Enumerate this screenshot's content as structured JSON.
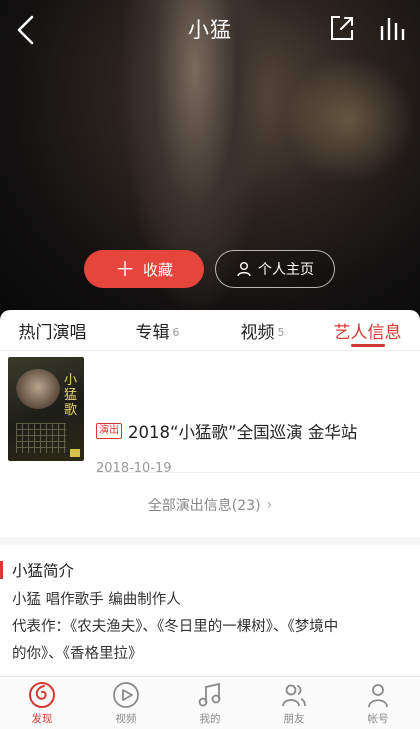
{
  "header": {
    "title": "小猛",
    "back_icon": "chevron-left-icon",
    "share_icon": "share-icon",
    "playing_icon": "now-playing-icon"
  },
  "actions": {
    "collect_label": "收藏",
    "homepage_label": "个人主页"
  },
  "tabs": [
    {
      "label": "热门演唱",
      "count": ""
    },
    {
      "label": "专辑",
      "count": "6"
    },
    {
      "label": "视频",
      "count": "5"
    },
    {
      "label": "艺人信息",
      "count": ""
    }
  ],
  "show": {
    "badge": "演出",
    "title": "2018“小猛歌”全国巡演 金华站",
    "date": "2018-10-19",
    "poster_text": "小猛歌"
  },
  "all_shows_label": "全部演出信息(23)",
  "intro": {
    "heading": "小猛简介",
    "line1": "小猛 唱作歌手 编曲制作人",
    "line2": "代表作：《农夫渔夫》、《冬日里的一棵树》、《梦境中",
    "line3": "的你》、《香格里拉》"
  },
  "bottom_nav": [
    {
      "label": "发现",
      "icon": "discover-icon"
    },
    {
      "label": "视频",
      "icon": "video-icon"
    },
    {
      "label": "我的",
      "icon": "music-icon"
    },
    {
      "label": "朋友",
      "icon": "friends-icon"
    },
    {
      "label": "帐号",
      "icon": "account-icon"
    }
  ],
  "colors": {
    "accent": "#d33a31",
    "collect_button": "#e5453b"
  }
}
